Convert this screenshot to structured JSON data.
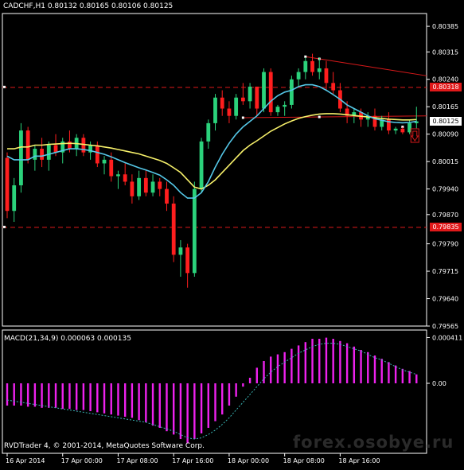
{
  "chart_header": "CADCHF,H1  0.80132 0.80165 0.80106 0.80125",
  "macd_header": "MACD(21,34,9) 0.000063 0.000135",
  "copyright": "RVDTrader 4, © 2001-2014, MetaQuotes Software Corp.",
  "watermark": "forex.osobye.ru",
  "colors": {
    "background": "#000000",
    "axis": "#ffffff",
    "grid": "#5a5a5a",
    "bull_candle": "#2bd27b",
    "bear_candle": "#ff1e1e",
    "ma_fast": "#55c8e8",
    "ma_slow": "#f6f06a",
    "level_line": "#e0191a",
    "trendline": "#d8191a",
    "macd_hist": "#ee22ee",
    "macd_signal": "#39b3b3",
    "price_tag": "#ffffff"
  },
  "levels": {
    "upper_label": "0.80318",
    "lower_label": "0.79835",
    "current_label": "0.80125"
  },
  "signal_icon": "down-arrow-icon",
  "chart_data": {
    "type": "candlestick",
    "symbol": "CADCHF",
    "timeframe": "H1",
    "ylim": [
      0.79565,
      0.8042
    ],
    "yticks": [
      "0.80385",
      "0.80315",
      "0.80240",
      "0.80165",
      "0.80090",
      "0.80015",
      "0.79940",
      "0.79870",
      "0.79790",
      "0.79715",
      "0.79640",
      "0.79565"
    ],
    "xticks": [
      "16 Apr 2014",
      "17 Apr 00:00",
      "17 Apr 08:00",
      "17 Apr 16:00",
      "18 Apr 00:00",
      "18 Apr 08:00",
      "18 Apr 16:00"
    ],
    "current_price": 0.80125,
    "horizontal_levels": [
      0.80218,
      0.79835
    ],
    "candles": [
      [
        0.80025,
        0.8004,
        0.7986,
        0.7988
      ],
      [
        0.7988,
        0.7997,
        0.7985,
        0.7995
      ],
      [
        0.7995,
        0.8012,
        0.7993,
        0.801
      ],
      [
        0.801,
        0.8011,
        0.8001,
        0.8002
      ],
      [
        0.8002,
        0.8006,
        0.7999,
        0.8005
      ],
      [
        0.8005,
        0.8008,
        0.8,
        0.8002
      ],
      [
        0.8002,
        0.8007,
        0.7999,
        0.8006
      ],
      [
        0.8006,
        0.8009,
        0.8003,
        0.8004
      ],
      [
        0.8004,
        0.8008,
        0.8001,
        0.8007
      ],
      [
        0.8007,
        0.801,
        0.8004,
        0.8005
      ],
      [
        0.8005,
        0.8009,
        0.8003,
        0.8008
      ],
      [
        0.8008,
        0.8009,
        0.8003,
        0.8004
      ],
      [
        0.8004,
        0.8007,
        0.8002,
        0.8006
      ],
      [
        0.8006,
        0.8007,
        0.8,
        0.8001
      ],
      [
        0.8001,
        0.8003,
        0.7998,
        0.8002
      ],
      [
        0.8002,
        0.8004,
        0.7996,
        0.79975
      ],
      [
        0.79975,
        0.7999,
        0.7994,
        0.7998
      ],
      [
        0.7998,
        0.8001,
        0.7995,
        0.7996
      ],
      [
        0.7996,
        0.7998,
        0.799,
        0.7992
      ],
      [
        0.7992,
        0.7999,
        0.7991,
        0.7997
      ],
      [
        0.7997,
        0.7999,
        0.7992,
        0.7993
      ],
      [
        0.7993,
        0.7998,
        0.7992,
        0.7996
      ],
      [
        0.7996,
        0.7997,
        0.7992,
        0.7994
      ],
      [
        0.7994,
        0.7996,
        0.7988,
        0.799
      ],
      [
        0.799,
        0.7992,
        0.7974,
        0.7976
      ],
      [
        0.7976,
        0.798,
        0.797,
        0.7978
      ],
      [
        0.7978,
        0.7979,
        0.7967,
        0.7971
      ],
      [
        0.7971,
        0.7996,
        0.797,
        0.7994
      ],
      [
        0.7994,
        0.8008,
        0.7993,
        0.8007
      ],
      [
        0.8007,
        0.8013,
        0.8005,
        0.8012
      ],
      [
        0.8012,
        0.802,
        0.801,
        0.8019
      ],
      [
        0.8019,
        0.8021,
        0.8014,
        0.8016
      ],
      [
        0.8016,
        0.8018,
        0.8012,
        0.8014
      ],
      [
        0.8014,
        0.802,
        0.8013,
        0.8019
      ],
      [
        0.8019,
        0.8023,
        0.8017,
        0.8018
      ],
      [
        0.8018,
        0.8023,
        0.8016,
        0.8022
      ],
      [
        0.8022,
        0.8022,
        0.8014,
        0.8016
      ],
      [
        0.8016,
        0.8027,
        0.8015,
        0.8026
      ],
      [
        0.8026,
        0.8027,
        0.8014,
        0.8015
      ],
      [
        0.8015,
        0.8017,
        0.8014,
        0.80165
      ],
      [
        0.80165,
        0.8018,
        0.8014,
        0.8017
      ],
      [
        0.8017,
        0.8025,
        0.8016,
        0.8024
      ],
      [
        0.8024,
        0.8027,
        0.8022,
        0.8026
      ],
      [
        0.8026,
        0.803,
        0.8024,
        0.8029
      ],
      [
        0.8029,
        0.8031,
        0.8025,
        0.8026
      ],
      [
        0.8026,
        0.803,
        0.8024,
        0.8027
      ],
      [
        0.8027,
        0.8029,
        0.8021,
        0.8023
      ],
      [
        0.8023,
        0.8026,
        0.802,
        0.8021
      ],
      [
        0.8021,
        0.8023,
        0.8015,
        0.8016
      ],
      [
        0.8016,
        0.8018,
        0.8012,
        0.8014
      ],
      [
        0.8014,
        0.8016,
        0.8012,
        0.8015
      ],
      [
        0.8015,
        0.8016,
        0.8011,
        0.8013
      ],
      [
        0.8013,
        0.8015,
        0.8011,
        0.8014
      ],
      [
        0.8014,
        0.8016,
        0.801,
        0.8011
      ],
      [
        0.8011,
        0.8014,
        0.801,
        0.8013
      ],
      [
        0.8013,
        0.8015,
        0.8009,
        0.801
      ],
      [
        0.801,
        0.8011,
        0.8009,
        0.80105
      ],
      [
        0.80105,
        0.8011,
        0.8009,
        0.80095
      ],
      [
        0.80095,
        0.8013,
        0.8009,
        0.8012
      ],
      [
        0.8012,
        0.80165,
        0.80106,
        0.80125
      ]
    ],
    "ma_fast": [
      0.8003,
      0.8002,
      0.8002,
      0.8002,
      0.8003,
      0.8003,
      0.80035,
      0.8004,
      0.80045,
      0.8005,
      0.8005,
      0.80048,
      0.80045,
      0.8004,
      0.80035,
      0.80028,
      0.8002,
      0.80012,
      0.80005,
      0.79998,
      0.79992,
      0.79985,
      0.79978,
      0.79965,
      0.7995,
      0.7993,
      0.79915,
      0.79915,
      0.7993,
      0.7996,
      0.8,
      0.80035,
      0.80065,
      0.8009,
      0.8011,
      0.80125,
      0.8014,
      0.8016,
      0.8018,
      0.80195,
      0.80205,
      0.8021,
      0.8022,
      0.80225,
      0.80225,
      0.8022,
      0.8021,
      0.80198,
      0.80185,
      0.8017,
      0.8016,
      0.8015,
      0.8014,
      0.80132,
      0.80128,
      0.80124,
      0.80122,
      0.80121,
      0.80122,
      0.80125
    ],
    "ma_slow": [
      0.8005,
      0.8005,
      0.80055,
      0.80055,
      0.8006,
      0.8006,
      0.80062,
      0.80063,
      0.80064,
      0.80065,
      0.80064,
      0.80062,
      0.8006,
      0.80058,
      0.80055,
      0.80052,
      0.80048,
      0.80044,
      0.8004,
      0.80036,
      0.8003,
      0.80024,
      0.80018,
      0.8001,
      0.79998,
      0.79985,
      0.79965,
      0.79945,
      0.7994,
      0.7995,
      0.79965,
      0.79985,
      0.80005,
      0.80025,
      0.80045,
      0.8006,
      0.80072,
      0.80085,
      0.80098,
      0.80108,
      0.80118,
      0.80126,
      0.80133,
      0.80138,
      0.80142,
      0.80145,
      0.80146,
      0.80146,
      0.80145,
      0.80143,
      0.80141,
      0.80139,
      0.80137,
      0.80135,
      0.80133,
      0.80131,
      0.8013,
      0.80129,
      0.80129,
      0.8013
    ],
    "trendline_pivots": [
      0.80302,
      0.80296,
      0.80216,
      0.80196,
      0.80135,
      0.80147
    ],
    "macd": {
      "ylim": [
        -0.0006,
        0.00045
      ],
      "yticks": [
        "0.000411",
        "0.00"
      ],
      "histogram": [
        -0.0002,
        -0.0002,
        -0.0002,
        -0.00021,
        -0.00021,
        -0.00022,
        -0.00022,
        -0.00022,
        -0.00023,
        -0.00023,
        -0.00024,
        -0.00024,
        -0.00025,
        -0.00026,
        -0.00027,
        -0.00028,
        -0.00029,
        -0.0003,
        -0.00031,
        -0.00033,
        -0.00035,
        -0.00038,
        -0.0004,
        -0.00043,
        -0.00046,
        -0.0005,
        -0.00054,
        -0.0005,
        -0.00045,
        -0.0004,
        -0.00034,
        -0.00028,
        -0.0002,
        -0.00012,
        -3e-05,
        5e-05,
        0.00014,
        0.0002,
        0.00024,
        0.00026,
        0.00028,
        0.00031,
        0.00034,
        0.00037,
        0.0004,
        0.0004,
        0.00041,
        0.0004,
        0.00038,
        0.00036,
        0.00033,
        0.0003,
        0.00028,
        0.00025,
        0.00022,
        0.00019,
        0.00016,
        0.00013,
        0.00011,
        8e-05
      ],
      "signal": [
        -0.00015,
        -0.00016,
        -0.00017,
        -0.00018,
        -0.00019,
        -0.0002,
        -0.00021,
        -0.00022,
        -0.00023,
        -0.00024,
        -0.00025,
        -0.00026,
        -0.00027,
        -0.00028,
        -0.00029,
        -0.0003,
        -0.00031,
        -0.00032,
        -0.00033,
        -0.00034,
        -0.00035,
        -0.00037,
        -0.00039,
        -0.00041,
        -0.00043,
        -0.00046,
        -0.00049,
        -0.0005,
        -0.00049,
        -0.00046,
        -0.00042,
        -0.00037,
        -0.00031,
        -0.00024,
        -0.00017,
        -0.0001,
        -3e-05,
        4e-05,
        0.0001,
        0.00015,
        0.00019,
        0.00023,
        0.00027,
        0.0003,
        0.00033,
        0.00035,
        0.00036,
        0.00036,
        0.00035,
        0.00033,
        0.00031,
        0.00029,
        0.00026,
        0.00023,
        0.00021,
        0.00018,
        0.00015,
        0.00012,
        0.0001,
        8e-05
      ]
    }
  }
}
